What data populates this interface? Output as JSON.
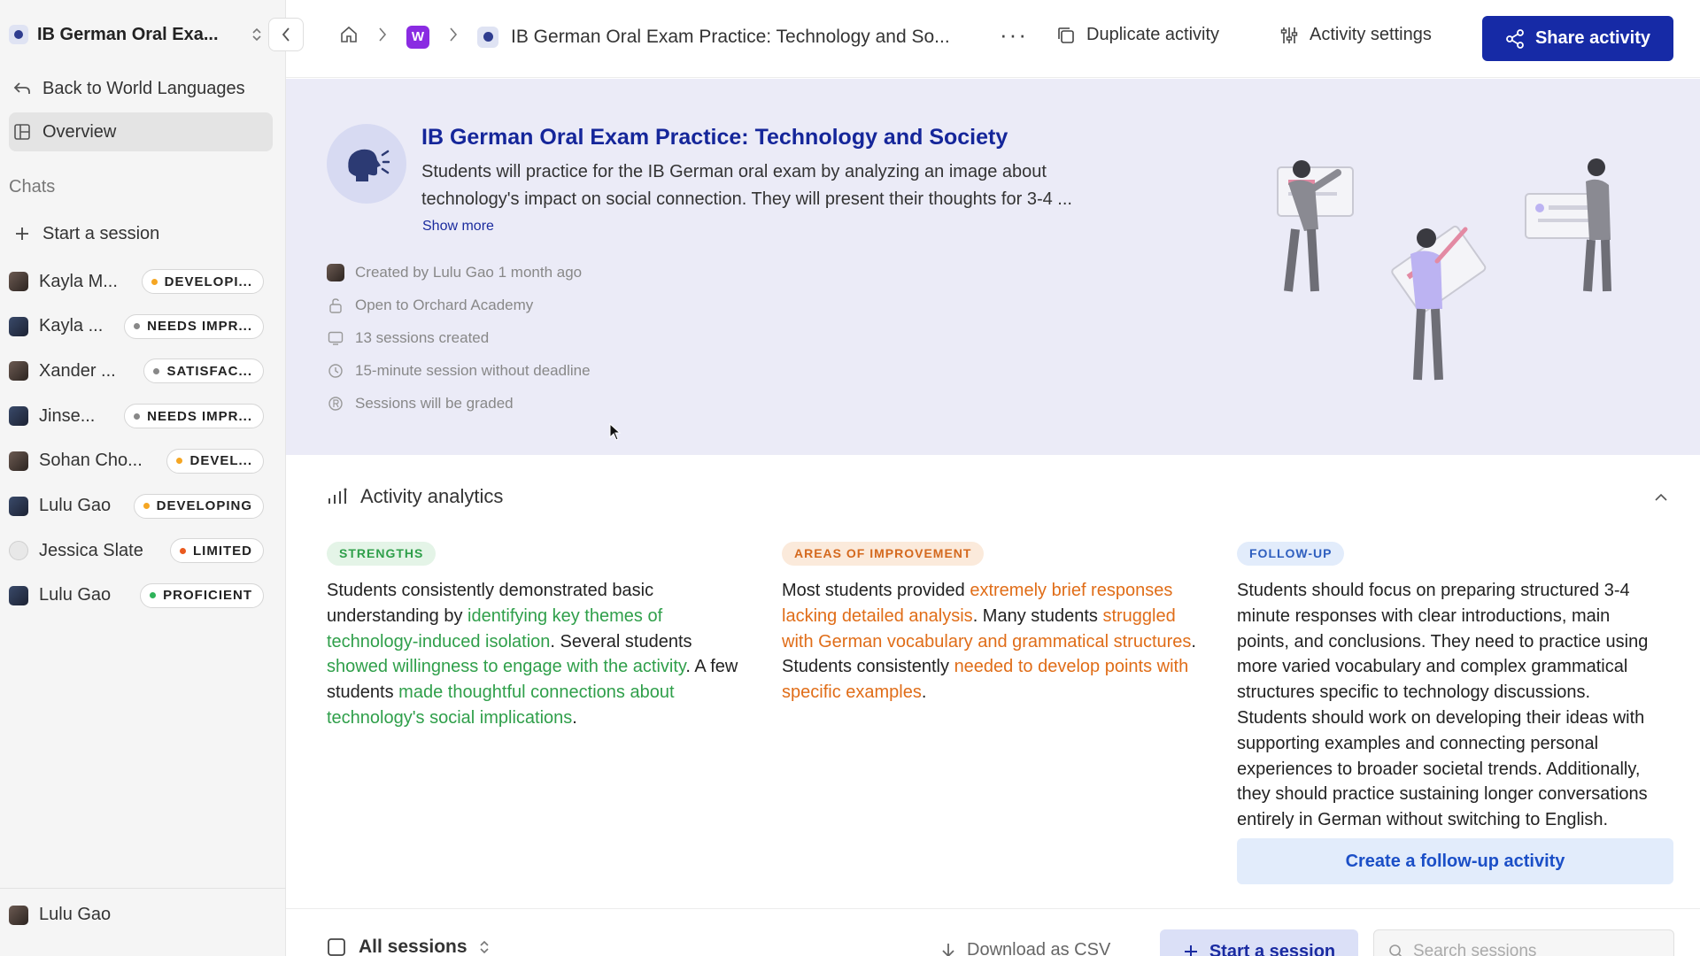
{
  "sidebar": {
    "workspace_title": "IB German Oral Exa...",
    "back_label": "Back to World Languages",
    "overview_label": "Overview",
    "chats_label": "Chats",
    "start_session_label": "Start a session",
    "chats": [
      {
        "name": "Kayla M...",
        "status": "DEVELOPI...",
        "dot": "#f5a623"
      },
      {
        "name": "Kayla ...",
        "status": "NEEDS IMPR...",
        "dot": "#888888"
      },
      {
        "name": "Xander ...",
        "status": "SATISFAC...",
        "dot": "#888888"
      },
      {
        "name": "Jinse...",
        "status": "NEEDS IMPR...",
        "dot": "#888888"
      },
      {
        "name": "Sohan Cho...",
        "status": "DEVEL...",
        "dot": "#f5a623"
      },
      {
        "name": "Lulu Gao",
        "status": "DEVELOPING",
        "dot": "#f5a623"
      },
      {
        "name": "Jessica Slate",
        "status": "LIMITED",
        "dot": "#ea5a1f"
      },
      {
        "name": "Lulu Gao",
        "status": "PROFICIENT",
        "dot": "#2fb35a"
      }
    ],
    "footer_user": "Lulu Gao"
  },
  "header": {
    "workspace_badge": "W",
    "activity_title": "IB German Oral Exam Practice: Technology and So...",
    "more_label": "···",
    "duplicate_label": "Duplicate activity",
    "settings_label": "Activity settings",
    "share_label": "Share activity"
  },
  "activity": {
    "title": "IB German Oral Exam Practice: Technology and Society",
    "description": "Students will practice for the IB German oral exam by analyzing an image about technology's impact on social connection. They will present their thoughts for 3-4 ...",
    "show_more": "Show more",
    "meta": {
      "created": "Created by Lulu Gao 1 month ago",
      "access": "Open to Orchard Academy",
      "sessions": "13 sessions created",
      "duration": "15-minute session without deadline",
      "grading": "Sessions will be graded"
    }
  },
  "analytics": {
    "title": "Activity analytics",
    "strengths": {
      "tag": "STRENGTHS",
      "p1": "Students consistently demonstrated basic understanding by ",
      "h1": "identifying key themes of technology-induced isolation",
      "p2": ". Several students ",
      "h2": "showed willingness to engage with the activity",
      "p3": ". A few students ",
      "h3": "made thoughtful connections about technology's social implications",
      "p4": "."
    },
    "improvement": {
      "tag": "AREAS OF IMPROVEMENT",
      "p1": "Most students provided ",
      "h1": "extremely brief responses lacking detailed analysis",
      "p2": ". Many students ",
      "h2": "struggled with German vocabulary and grammatical structures",
      "p3": ". Students consistently ",
      "h3": "needed to develop points with specific examples",
      "p4": "."
    },
    "followup": {
      "tag": "FOLLOW-UP",
      "text": "Students should focus on preparing structured 3-4 minute responses with clear introductions, main points, and conclusions. They need to practice using more varied vocabulary and complex grammatical structures specific to technology discussions. Students should work on developing their ideas with supporting examples and connecting personal experiences to broader societal trends. Additionally, they should practice sustaining longer conversations entirely in German without switching to English.",
      "button": "Create a follow-up activity"
    }
  },
  "sessions": {
    "title": "All sessions",
    "download_label": "Download as CSV",
    "start_label": "Start a session",
    "search_placeholder": "Search sessions"
  },
  "colors": {
    "brand": "#162aa6",
    "strength": "#2f9f4a",
    "improvement": "#e06d18",
    "followup": "#1b4fc7"
  }
}
